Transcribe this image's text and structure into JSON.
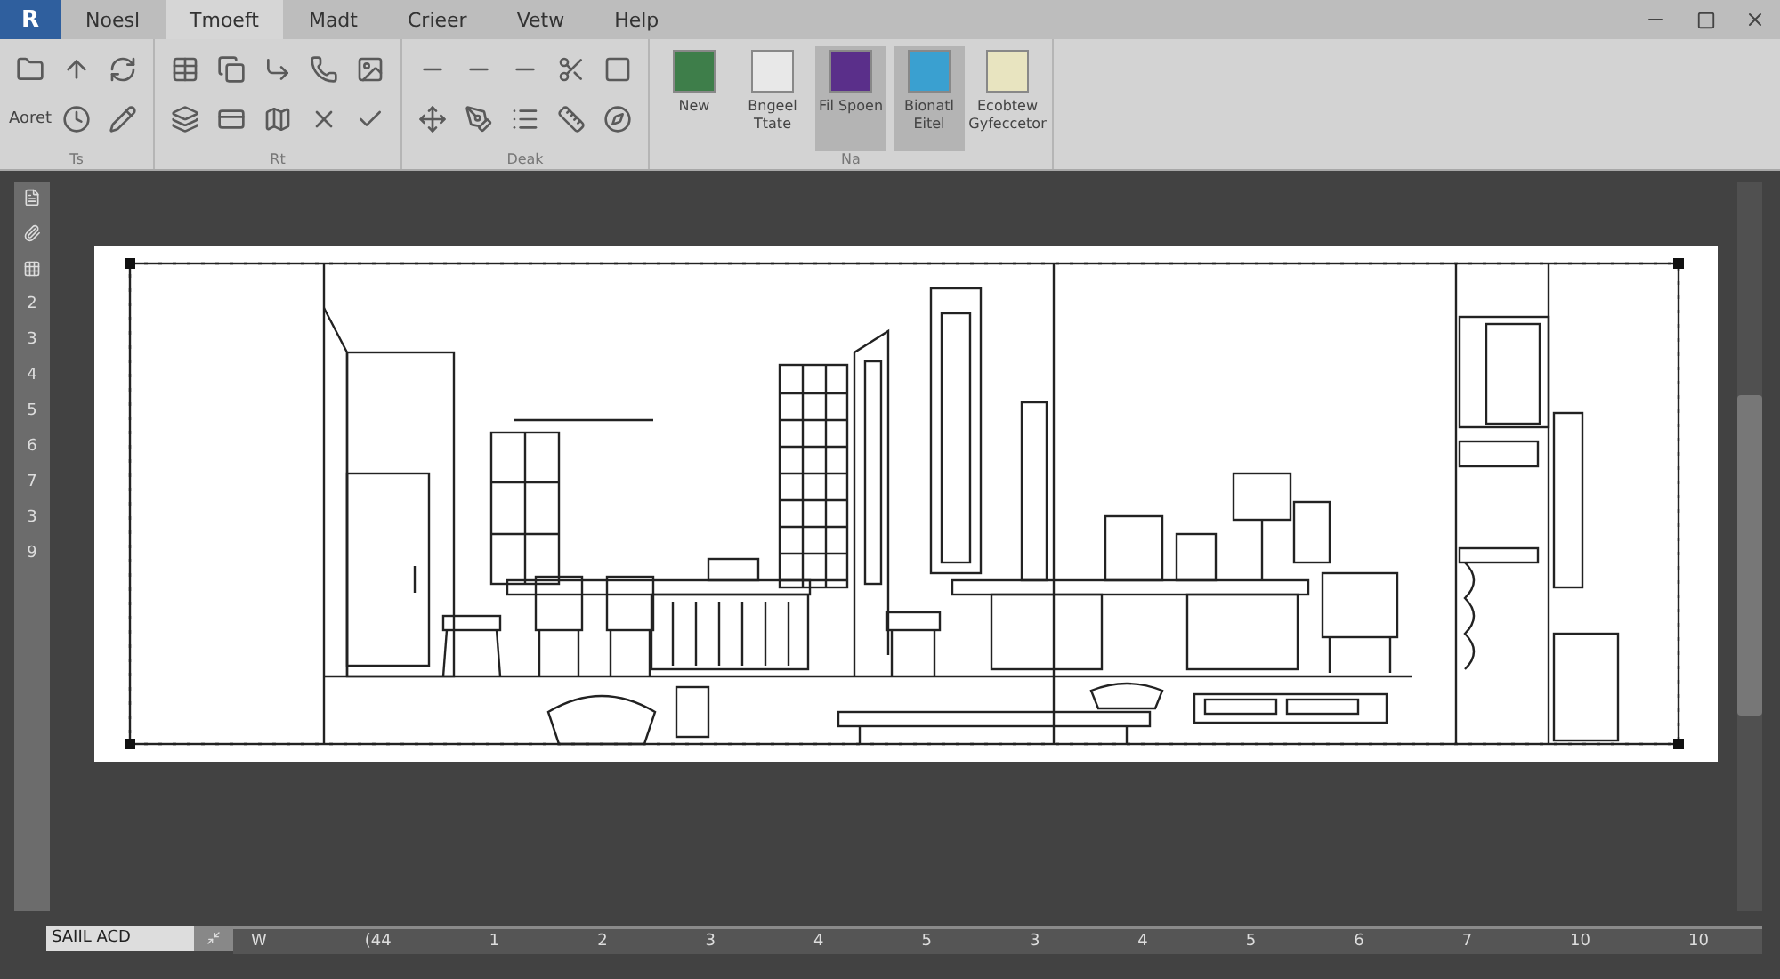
{
  "logo": "R",
  "menu": [
    {
      "label": "Noesl",
      "selected": false
    },
    {
      "label": "Tmoeft",
      "selected": true
    },
    {
      "label": "Madt",
      "selected": false
    },
    {
      "label": "Crieer",
      "selected": false
    },
    {
      "label": "Vetw",
      "selected": false
    },
    {
      "label": "Help",
      "selected": false
    }
  ],
  "ribbon": {
    "groups": [
      {
        "label": "Ts",
        "tool_label": "Aoret"
      },
      {
        "label": "Rt"
      },
      {
        "label": "Deak"
      },
      {
        "label": "Na",
        "large_tools": [
          {
            "label": "New",
            "selected": false
          },
          {
            "label": "Bngeel Ttate",
            "selected": false
          },
          {
            "label": "Fil Spoen",
            "selected": true
          },
          {
            "label": "Bionatl Eitel",
            "selected": true
          },
          {
            "label": "Ecobtew Gyfeccetor",
            "selected": false
          }
        ]
      }
    ]
  },
  "left_ruler": [
    "2",
    "3",
    "4",
    "5",
    "6",
    "7",
    "3",
    "9"
  ],
  "command_field": {
    "value": "SAIIL ACD"
  },
  "bottom_ruler": [
    "W",
    "(44",
    "1",
    "2",
    "3",
    "4",
    "5",
    "3",
    "4",
    "5",
    "6",
    "7",
    "10",
    "10"
  ]
}
